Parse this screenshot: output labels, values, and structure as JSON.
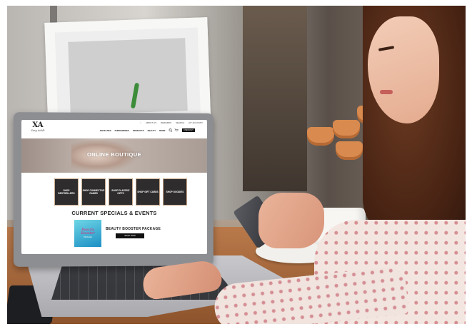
{
  "site": {
    "logo_mark": "XA",
    "logo_text": "Sexy Adult",
    "top_links": [
      "♡",
      "ABOUT US",
      "REWARDS",
      "SEARCH",
      "MY ACCOUNT"
    ],
    "main_nav": [
      "NOVELTIES",
      "PHEROMONES",
      "PRODUCTS",
      "BEAUTY",
      "MORE"
    ],
    "checkout_label": "CHECKOUT",
    "hero_title": "ONLINE BOUTIQUE",
    "tiles": [
      {
        "label": "SHOP BESTSELLERS"
      },
      {
        "label": "SHOP CONNECTIVE GAMES"
      },
      {
        "label": "SHOP PLAYERS' GIFTS"
      },
      {
        "label": "SHOP GIFT CARDS"
      },
      {
        "label": "SHOP GOODIES"
      }
    ],
    "specials_title": "CURRENT SPECIALS & EVENTS",
    "promo": {
      "image_line1": "Beauty",
      "image_line2": "Booster",
      "image_line3": "PACKAGE",
      "label": "BEAUTY BOOSTER PACKAGE",
      "button": "SHOP NOW"
    }
  },
  "colors": {
    "table": "#8d532c",
    "tile_bg": "#2e2c2c",
    "promo_bg": "#1c8fc4",
    "promo_text": "#e8206e"
  }
}
